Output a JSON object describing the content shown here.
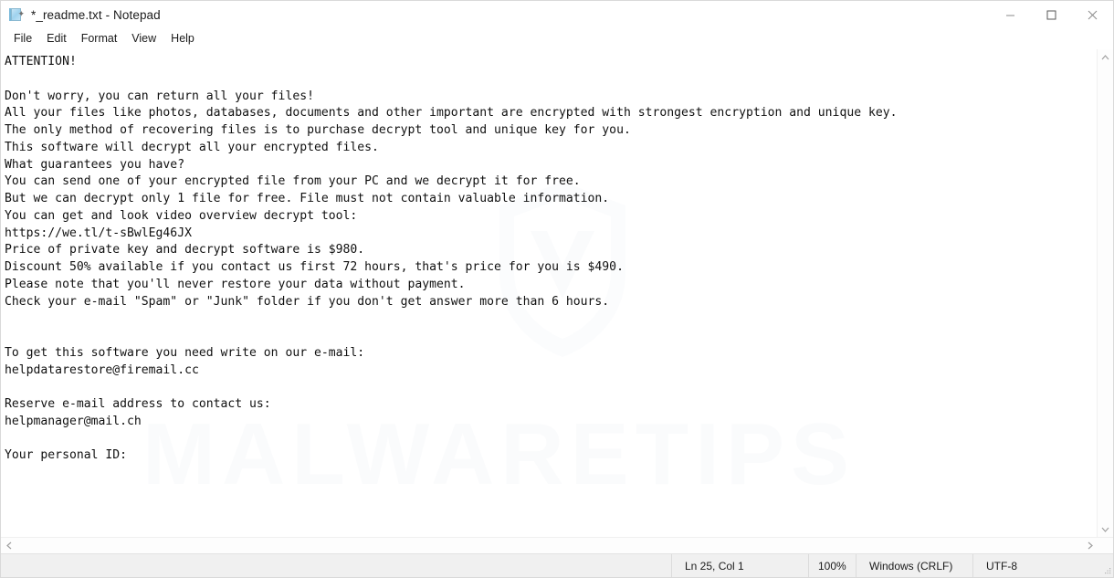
{
  "window": {
    "title": "*_readme.txt - Notepad",
    "icon": "notepad-icon",
    "controls": {
      "minimize": "minimize-icon",
      "maximize": "maximize-icon",
      "close": "close-icon"
    }
  },
  "menubar": {
    "items": [
      {
        "label": "File"
      },
      {
        "label": "Edit"
      },
      {
        "label": "Format"
      },
      {
        "label": "View"
      },
      {
        "label": "Help"
      }
    ]
  },
  "document": {
    "content": "ATTENTION!\n\nDon't worry, you can return all your files!\nAll your files like photos, databases, documents and other important are encrypted with strongest encryption and unique key.\nThe only method of recovering files is to purchase decrypt tool and unique key for you.\nThis software will decrypt all your encrypted files.\nWhat guarantees you have?\nYou can send one of your encrypted file from your PC and we decrypt it for free.\nBut we can decrypt only 1 file for free. File must not contain valuable information.\nYou can get and look video overview decrypt tool:\nhttps://we.tl/t-sBwlEg46JX\nPrice of private key and decrypt software is $980.\nDiscount 50% available if you contact us first 72 hours, that's price for you is $490.\nPlease note that you'll never restore your data without payment.\nCheck your e-mail \"Spam\" or \"Junk\" folder if you don't get answer more than 6 hours.\n\n\nTo get this software you need write on our e-mail:\nhelpdatarestore@firemail.cc\n\nReserve e-mail address to contact us:\nhelpmanager@mail.ch\n\nYour personal ID:",
    "lines": [
      "ATTENTION!",
      "",
      "Don't worry, you can return all your files!",
      "All your files like photos, databases, documents and other important are encrypted with strongest encryption and unique key.",
      "The only method of recovering files is to purchase decrypt tool and unique key for you.",
      "This software will decrypt all your encrypted files.",
      "What guarantees you have?",
      "You can send one of your encrypted file from your PC and we decrypt it for free.",
      "But we can decrypt only 1 file for free. File must not contain valuable information.",
      "You can get and look video overview decrypt tool:",
      "https://we.tl/t-sBwlEg46JX",
      "Price of private key and decrypt software is $980.",
      "Discount 50% available if you contact us first 72 hours, that's price for you is $490.",
      "Please note that you'll never restore your data without payment.",
      "Check your e-mail \"Spam\" or \"Junk\" folder if you don't get answer more than 6 hours.",
      "",
      "",
      "To get this software you need write on our e-mail:",
      "helpdatarestore@firemail.cc",
      "",
      "Reserve e-mail address to contact us:",
      "helpmanager@mail.ch",
      "",
      "Your personal ID:"
    ]
  },
  "watermark": {
    "text": "MALWARETIPS",
    "color": "#fafbfc"
  },
  "scrollbars": {
    "vertical": {
      "up": "chevron-up-icon",
      "down": "chevron-down-icon"
    },
    "horizontal": {
      "left": "chevron-left-icon",
      "right": "chevron-right-icon"
    }
  },
  "statusbar": {
    "position": "Ln 25, Col 1",
    "zoom": "100%",
    "line_ending": "Windows (CRLF)",
    "encoding": "UTF-8"
  }
}
